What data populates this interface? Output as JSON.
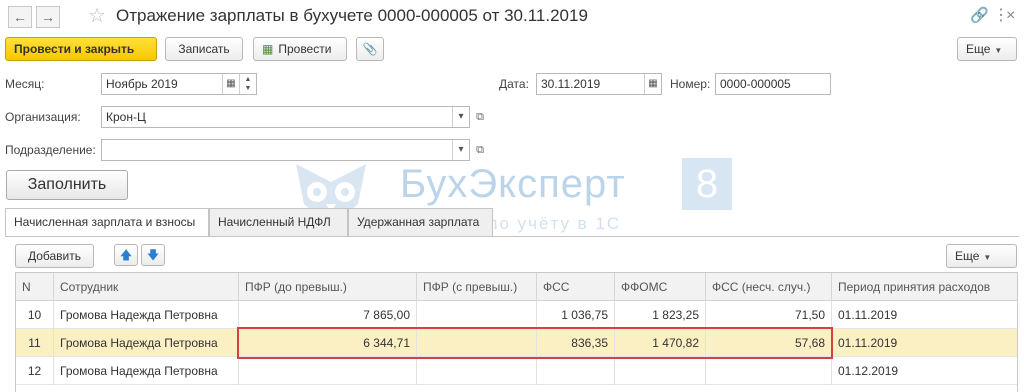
{
  "window": {
    "title": "Отражение зарплаты в бухучете 0000-000005 от 30.11.2019",
    "nav_back_icon": "arrow-left-icon",
    "nav_forward_icon": "arrow-right-icon",
    "favorite_icon": "star-icon",
    "link_icon": "link-icon",
    "menu_icon": "more-vertical-icon",
    "close_icon": "close-icon"
  },
  "toolbar": {
    "post_close_label": "Провести и закрыть",
    "save_label": "Записать",
    "post_label": "Провести",
    "attach_icon": "paperclip-icon",
    "more_label": "Еще"
  },
  "form": {
    "month_label": "Месяц:",
    "month_value": "Ноябрь 2019",
    "date_label": "Дата:",
    "date_value": "30.11.2019",
    "number_label": "Номер:",
    "number_value": "0000-000005",
    "org_label": "Организация:",
    "org_value": "Крон-Ц",
    "dept_label": "Подразделение:",
    "dept_value": "",
    "fill_label": "Заполнить"
  },
  "watermark": {
    "brand": "БухЭксперт",
    "badge": "8",
    "tagline": "Советов по учёту в 1С"
  },
  "tabs": [
    {
      "label": "Начисленная зарплата и взносы",
      "active": true
    },
    {
      "label": "Начисленный НДФЛ",
      "active": false
    },
    {
      "label": "Удержанная зарплата",
      "active": false
    }
  ],
  "table_toolbar": {
    "add_label": "Добавить",
    "more_label": "Еще"
  },
  "table": {
    "columns": [
      "N",
      "Сотрудник",
      "ПФР (до превыш.)",
      "ПФР (с превыш.)",
      "ФСС",
      "ФФОМС",
      "ФСС (несч. случ.)",
      "Период принятия расходов"
    ],
    "rows": [
      [
        "10",
        "Громова Надежда Петровна",
        "7 865,00",
        "",
        "1 036,75",
        "1 823,25",
        "71,50",
        "01.11.2019"
      ],
      [
        "11",
        "Громова Надежда Петровна",
        "6 344,71",
        "",
        "836,35",
        "1 470,82",
        "57,68",
        "01.11.2019"
      ],
      [
        "12",
        "Громова Надежда Петровна",
        "",
        "",
        "",
        "",
        "",
        "01.12.2019"
      ]
    ],
    "selected_row": 1
  },
  "colors": {
    "primary_button": "#f7c800",
    "selected_row": "#fbefc4",
    "highlight_border": "#d64040",
    "arrow_blue": "#2b7fd1"
  }
}
